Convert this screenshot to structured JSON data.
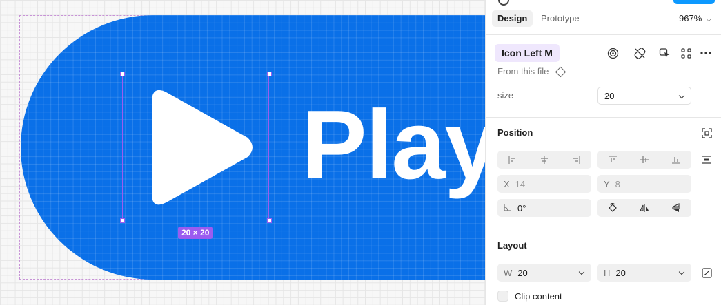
{
  "canvas": {
    "button_label": "Play",
    "size_badge": "20 × 20"
  },
  "panel": {
    "tabs": [
      {
        "label": "Design",
        "active": true
      },
      {
        "label": "Prototype",
        "active": false
      }
    ],
    "zoom": "967%",
    "component": {
      "name": "Icon Left M",
      "source": "From this file"
    },
    "properties": {
      "size_label": "size",
      "size_value": "20"
    },
    "position": {
      "title": "Position",
      "x_label": "X",
      "x_value": "14",
      "y_label": "Y",
      "y_value": "8",
      "rotation": "0°"
    },
    "layout": {
      "title": "Layout",
      "w_label": "W",
      "w_value": "20",
      "h_label": "H",
      "h_value": "20",
      "clip_content": "Clip content"
    }
  },
  "colors": {
    "button_blue": "#0a70e8",
    "selection_purple": "#9b5cf0",
    "accent_blue": "#0d99ff"
  }
}
